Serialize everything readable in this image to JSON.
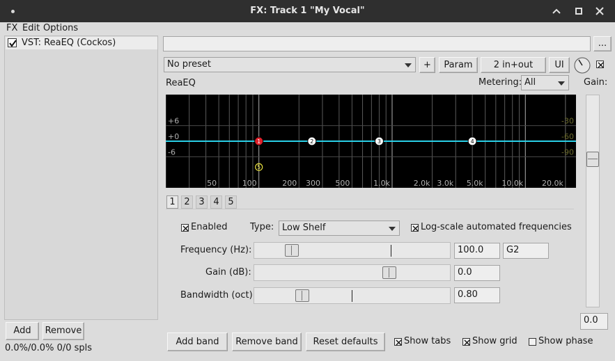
{
  "window": {
    "title": "FX: Track 1 \"My Vocal\""
  },
  "menu": {
    "fx": "FX",
    "edit": "Edit",
    "options": "Options"
  },
  "fx_chain": {
    "items": [
      {
        "label": "VST: ReaEQ (Cockos)",
        "enabled": true
      }
    ],
    "add_label": "Add",
    "remove_label": "Remove",
    "status": "0.0%/0.0% 0/0 spls"
  },
  "plugin": {
    "more_label": "...",
    "preset": "No preset",
    "plus_label": "+",
    "param_label": "Param",
    "io_label": "2 in+out",
    "ui_label": "UI",
    "name": "ReaEQ",
    "metering_label": "Metering:",
    "metering_value": "All",
    "gain_label": "Gain:",
    "gain_value": "0.0",
    "gain_fraction": 0.5
  },
  "graph": {
    "db_labels": [
      "+6",
      "+0",
      "-6"
    ],
    "right_labels": [
      "-30",
      "-60",
      "-90"
    ],
    "freq_labels": [
      "50",
      "100",
      "200",
      "300",
      "500",
      "1.0k",
      "2.0k",
      "3.0k",
      "5.0k",
      "10.0k",
      "20.0k"
    ],
    "bands": [
      {
        "id": "1",
        "freq": 100,
        "gain_db": 0,
        "color": "#e0202a",
        "selected": true
      },
      {
        "id": "2",
        "freq": 250,
        "gain_db": 0,
        "color": "#ffffff"
      },
      {
        "id": "3",
        "freq": 800,
        "gain_db": 0,
        "color": "#ffffff"
      },
      {
        "id": "4",
        "freq": 4000,
        "gain_db": 0,
        "color": "#ffffff"
      },
      {
        "id": "5",
        "freq": 100,
        "gain_db": -10,
        "color": "#e8e040",
        "hollow": true
      }
    ],
    "curve_color": "#2ad0e8"
  },
  "band_tabs": [
    "1",
    "2",
    "3",
    "4",
    "5"
  ],
  "band": {
    "enabled_label": "Enabled",
    "type_label": "Type:",
    "type_value": "Low Shelf",
    "logscale_label": "Log-scale automated frequencies",
    "frequency_label": "Frequency (Hz):",
    "frequency_value": "100.0",
    "frequency_note": "G2",
    "frequency_fraction": 0.17,
    "gain_label": "Gain (dB):",
    "gain_value": "0.0",
    "gain_fraction": 0.705,
    "bandwidth_label": "Bandwidth (oct):",
    "bandwidth_value": "0.80",
    "bandwidth_fraction": 0.225
  },
  "bottom": {
    "add_band": "Add band",
    "remove_band": "Remove band",
    "reset_defaults": "Reset defaults",
    "show_tabs": "Show tabs",
    "show_grid": "Show grid",
    "show_phase": "Show phase"
  }
}
